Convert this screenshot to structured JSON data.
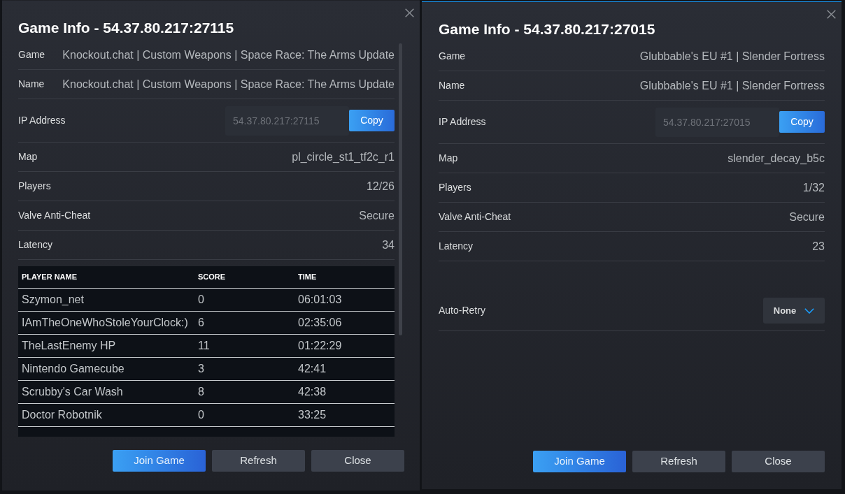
{
  "dialogs": [
    {
      "focused": false,
      "title": "Game Info - 54.37.80.217:27115",
      "fields": [
        {
          "kind": "text",
          "label": "Game",
          "value": "Knockout.chat | Custom Weapons | Space Race: The Arms Update"
        },
        {
          "kind": "text",
          "label": "Name",
          "value": "Knockout.chat | Custom Weapons | Space Race: The Arms Update"
        },
        {
          "kind": "address",
          "label": "IP Address",
          "value": "54.37.80.217:27115",
          "button": "Copy"
        },
        {
          "kind": "text",
          "label": "Map",
          "value": "pl_circle_st1_tf2c_r1"
        },
        {
          "kind": "text",
          "label": "Players",
          "value": "12/26"
        },
        {
          "kind": "text",
          "label": "Valve Anti-Cheat",
          "value": "Secure"
        },
        {
          "kind": "text",
          "label": "Latency",
          "value": "34"
        }
      ],
      "players": {
        "columns": [
          "PLAYER NAME",
          "SCORE",
          "TIME"
        ],
        "rows": [
          [
            "Szymon_net",
            "0",
            "06:01:03"
          ],
          [
            "IAmTheOneWhoStoleYourClock:)",
            "6",
            "02:35:06"
          ],
          [
            "TheLastEnemy HP",
            "11",
            "01:22:29"
          ],
          [
            "Nintendo Gamecube",
            "3",
            "42:41"
          ],
          [
            "Scrubby's Car Wash",
            "8",
            "42:38"
          ],
          [
            "Doctor Robotnik",
            "0",
            "33:25"
          ]
        ]
      },
      "buttons": [
        {
          "label": "Join Game",
          "primary": true
        },
        {
          "label": "Refresh",
          "primary": false
        },
        {
          "label": "Close",
          "primary": false
        }
      ]
    },
    {
      "focused": true,
      "title": "Game Info - 54.37.80.217:27015",
      "fields": [
        {
          "kind": "text",
          "label": "Game",
          "value": "Glubbable's EU #1 | Slender Fortress"
        },
        {
          "kind": "text",
          "label": "Name",
          "value": "Glubbable's EU #1 | Slender Fortress"
        },
        {
          "kind": "address",
          "label": "IP Address",
          "value": "54.37.80.217:27015",
          "button": "Copy"
        },
        {
          "kind": "text",
          "label": "Map",
          "value": "slender_decay_b5c"
        },
        {
          "kind": "text",
          "label": "Players",
          "value": "1/32"
        },
        {
          "kind": "text",
          "label": "Valve Anti-Cheat",
          "value": "Secure"
        },
        {
          "kind": "text",
          "label": "Latency",
          "value": "23"
        }
      ],
      "settings": [
        {
          "kind": "dropdown",
          "label": "Auto-Retry",
          "value": "None"
        }
      ],
      "buttons": [
        {
          "label": "Join Game",
          "primary": true
        },
        {
          "label": "Refresh",
          "primary": false
        },
        {
          "label": "Close",
          "primary": false
        }
      ]
    }
  ]
}
